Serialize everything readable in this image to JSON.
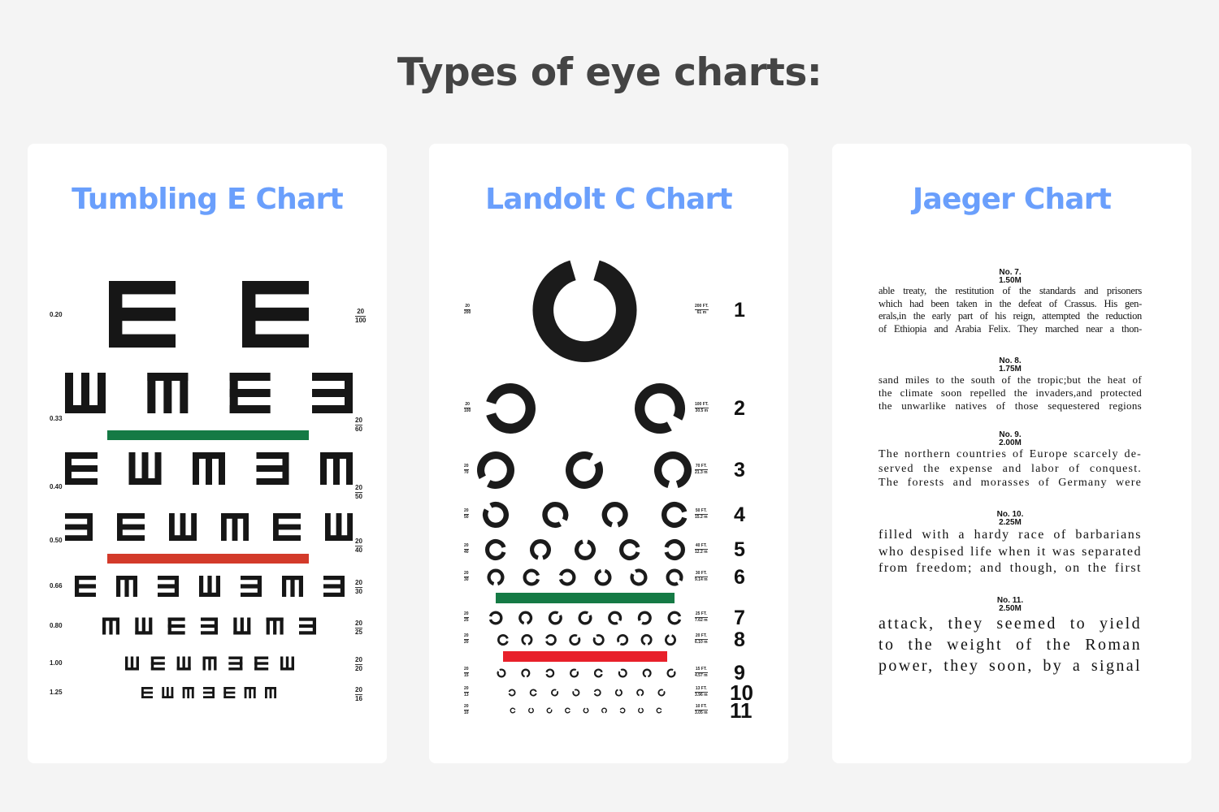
{
  "page": {
    "title": "Types of eye charts:",
    "background": "#f4f4f4",
    "heading_color": "#6a9ffc"
  },
  "cards": [
    {
      "title": "Tumbling E Chart",
      "bar_colors": {
        "green": "#157a45",
        "red": "#d33a2a"
      },
      "rows": [
        {
          "decimal": "0.20",
          "snellen_num": "20",
          "snellen_den": "100",
          "letters": [
            "E",
            "E"
          ]
        },
        {
          "decimal": "0.33",
          "snellen_num": "20",
          "snellen_den": "60",
          "letters": [
            "W",
            "M",
            "E",
            "3"
          ]
        },
        {
          "decimal": "0.40",
          "snellen_num": "20",
          "snellen_den": "50",
          "letters": [
            "E",
            "W",
            "M",
            "3",
            "M"
          ]
        },
        {
          "decimal": "0.50",
          "snellen_num": "20",
          "snellen_den": "40",
          "letters": [
            "3",
            "E",
            "W",
            "M",
            "E",
            "W"
          ]
        },
        {
          "decimal": "0.66",
          "snellen_num": "20",
          "snellen_den": "30",
          "letters": [
            "E",
            "M",
            "3",
            "W",
            "3",
            "M",
            "3"
          ]
        },
        {
          "decimal": "0.80",
          "snellen_num": "20",
          "snellen_den": "25",
          "letters": [
            "M",
            "W",
            "E",
            "3",
            "W",
            "M",
            "3"
          ]
        },
        {
          "decimal": "1.00",
          "snellen_num": "20",
          "snellen_den": "20",
          "letters": [
            "W",
            "E",
            "W",
            "M",
            "3",
            "E",
            "W"
          ]
        },
        {
          "decimal": "1.25",
          "snellen_num": "20",
          "snellen_den": "16",
          "letters": [
            "E",
            "W",
            "M",
            "3",
            "E",
            "M",
            "M"
          ]
        }
      ]
    },
    {
      "title": "Landolt C Chart",
      "bar_colors": {
        "green": "#157a45",
        "red": "#e8202a"
      },
      "rows": [
        {
          "line": "1",
          "snellen_num": "20",
          "snellen_den": "200",
          "distance_ft": "200 FT.",
          "distance_m": "61 m",
          "gaps": [
            "top"
          ]
        },
        {
          "line": "2",
          "snellen_num": "20",
          "snellen_den": "100",
          "distance_ft": "100 FT.",
          "distance_m": "30.5 m",
          "gaps": [
            "left",
            "bottom-right"
          ]
        },
        {
          "line": "3",
          "snellen_num": "20",
          "snellen_den": "70",
          "distance_ft": "70 FT.",
          "distance_m": "21.3 m",
          "gaps": [
            "bottom-left",
            "top-right",
            "bottom"
          ]
        },
        {
          "line": "4",
          "snellen_num": "20",
          "snellen_den": "50",
          "distance_ft": "50 FT.",
          "distance_m": "15.2 m",
          "gaps": [
            "top-left",
            "bottom-right",
            "bottom",
            "right"
          ]
        },
        {
          "line": "5",
          "snellen_num": "20",
          "snellen_den": "40",
          "distance_ft": "40 FT.",
          "distance_m": "12.2 m",
          "gaps": [
            "right",
            "bottom",
            "top",
            "right",
            "left"
          ]
        },
        {
          "line": "6",
          "snellen_num": "20",
          "snellen_den": "30",
          "distance_ft": "30 FT.",
          "distance_m": "9.14 m",
          "gaps": [
            "bottom",
            "right",
            "left",
            "top",
            "top-left",
            "bottom-right"
          ]
        },
        {
          "line": "7",
          "snellen_num": "20",
          "snellen_den": "25",
          "distance_ft": "25 FT.",
          "distance_m": "7.62 m",
          "gaps": [
            "left",
            "bottom",
            "top-right",
            "top-right",
            "bottom-right",
            "bottom-left",
            "right"
          ]
        },
        {
          "line": "8",
          "snellen_num": "20",
          "snellen_den": "20",
          "distance_ft": "20 FT.",
          "distance_m": "6.10 m",
          "gaps": [
            "right",
            "bottom",
            "left",
            "top-right",
            "top-left",
            "bottom-left",
            "bottom",
            "top"
          ]
        },
        {
          "line": "9",
          "snellen_num": "20",
          "snellen_den": "15",
          "distance_ft": "15 FT.",
          "distance_m": "4.57 m",
          "gaps": [
            "top-left",
            "bottom",
            "left",
            "top-right",
            "right",
            "top-left",
            "bottom",
            "top-right"
          ]
        },
        {
          "line": "10",
          "snellen_num": "20",
          "snellen_den": "13",
          "distance_ft": "13 FT.",
          "distance_m": "3.96 m",
          "gaps": [
            "left",
            "right",
            "top-right",
            "top-left",
            "left",
            "top",
            "bottom",
            "top-right"
          ]
        },
        {
          "line": "11",
          "snellen_num": "20",
          "snellen_den": "10",
          "distance_ft": "10 FT.",
          "distance_m": "3.05 m",
          "gaps": [
            "right",
            "top",
            "top-right",
            "right",
            "top",
            "bottom",
            "left",
            "top",
            "right"
          ]
        }
      ]
    },
    {
      "title": "Jaeger Chart",
      "sections": [
        {
          "number": "No. 7.",
          "size": "1.50M",
          "lines": [
            "able treaty, the restitution of the standards and prisoners",
            "which had been taken in the defeat of Crassus. His gen-",
            "erals,in the early part of his reign, attempted the reduction",
            "of Ethiopia and Arabia Felix. They marched near a thon-"
          ]
        },
        {
          "number": "No. 8.",
          "size": "1.75M",
          "lines": [
            "sand miles to the south of the tropic;but the heat of",
            "the climate soon repelled the invaders,and protected",
            "the unwarlike natives of those sequestered regions"
          ]
        },
        {
          "number": "No. 9.",
          "size": "2.00M",
          "lines": [
            "The northern countries of Europe scarcely de-",
            "served the expense and labor of conquest.",
            "The forests and morasses of Germany were"
          ]
        },
        {
          "number": "No. 10.",
          "size": "2.25M",
          "lines": [
            "filled with a hardy race of barbarians",
            "who despised life when it was separated",
            "from freedom; and though, on the first"
          ]
        },
        {
          "number": "No. 11.",
          "size": "2.50M",
          "lines": [
            "attack, they seemed to yield",
            "to the weight of the Roman",
            "power, they soon, by a signal"
          ]
        }
      ]
    }
  ]
}
